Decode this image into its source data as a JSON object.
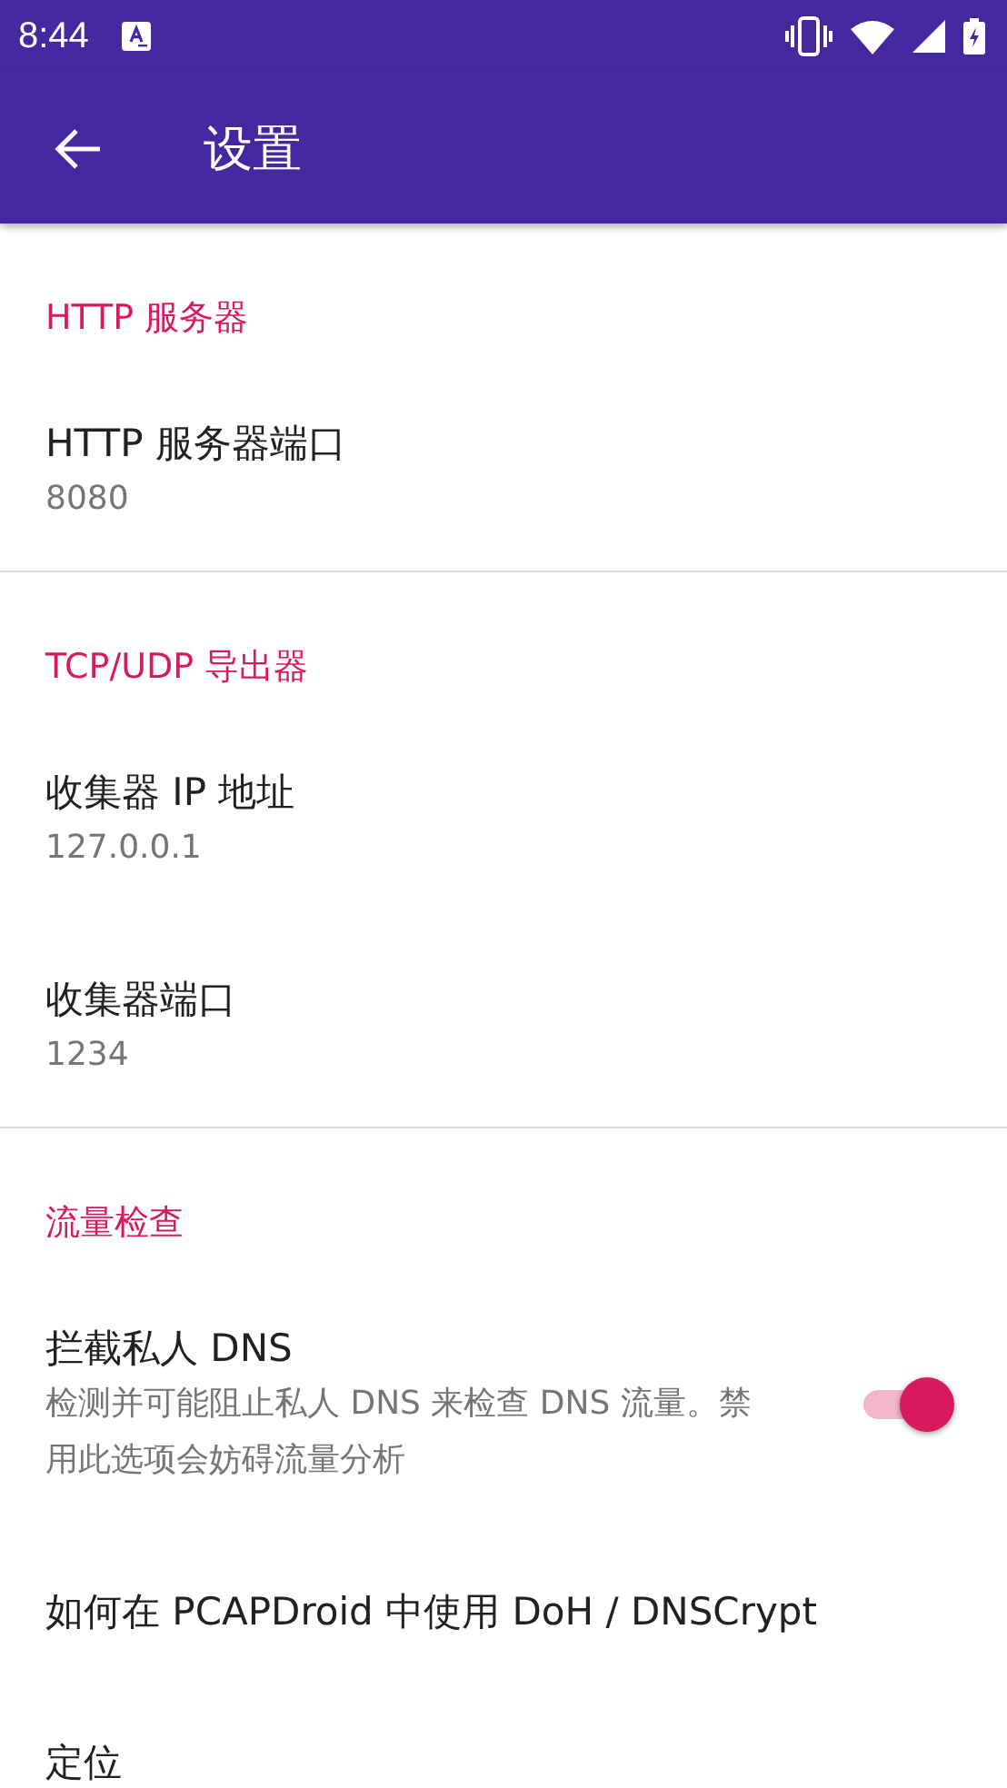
{
  "status_bar": {
    "time": "8:44"
  },
  "toolbar": {
    "title": "设置"
  },
  "sections": [
    {
      "title": "HTTP 服务器",
      "items": [
        {
          "kind": "text",
          "title": "HTTP 服务器端口",
          "summary": "8080"
        }
      ]
    },
    {
      "title": "TCP/UDP 导出器",
      "items": [
        {
          "kind": "text",
          "title": "收集器 IP 地址",
          "summary": "127.0.0.1"
        },
        {
          "kind": "text",
          "title": "收集器端口",
          "summary": "1234"
        }
      ]
    },
    {
      "title": "流量检查",
      "items": [
        {
          "kind": "switch",
          "title": "拦截私人 DNS",
          "summary": "检测并可能阻止私人 DNS 来检查 DNS 流量。禁用此选项会妨碍流量分析",
          "on": true
        },
        {
          "kind": "text",
          "title": "如何在 PCAPDroid 中使用 DoH / DNSCrypt"
        },
        {
          "kind": "text",
          "title": "定位"
        }
      ]
    }
  ]
}
